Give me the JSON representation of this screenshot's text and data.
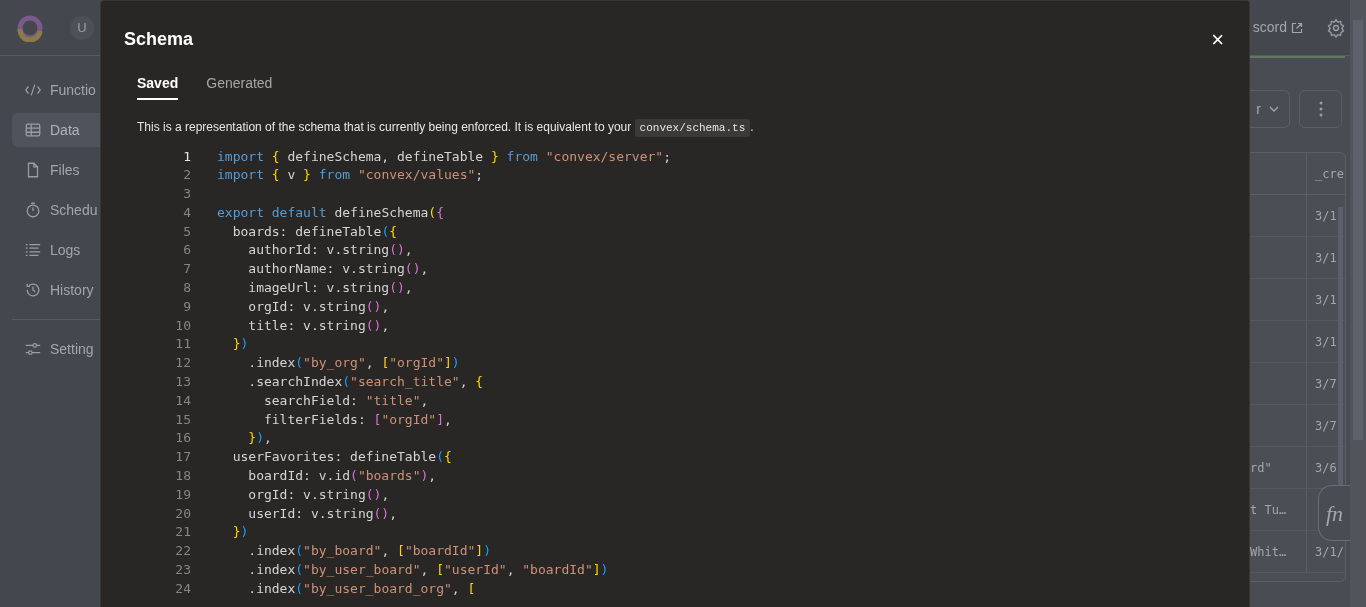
{
  "header": {
    "avatar": "U",
    "link": "scord"
  },
  "sidebar": {
    "items": [
      {
        "label": "Functio",
        "kind": "code",
        "selected": false
      },
      {
        "label": "Data",
        "kind": "table",
        "selected": true
      },
      {
        "label": "Files",
        "kind": "file",
        "selected": false
      },
      {
        "label": "Schedu",
        "kind": "timer",
        "selected": false
      },
      {
        "label": "Logs",
        "kind": "list",
        "selected": false
      },
      {
        "label": "History",
        "kind": "history",
        "selected": false
      }
    ],
    "footer_items": [
      {
        "label": "Setting",
        "kind": "sliders",
        "selected": false
      }
    ]
  },
  "toolbar": {
    "dropdown": "r"
  },
  "table": {
    "columns": [
      "_cre"
    ],
    "rows": [
      {
        "column_2": "3/1"
      },
      {
        "column_2": "3/1"
      },
      {
        "column_2": "3/1"
      },
      {
        "column_2": "3/1"
      },
      {
        "column_2": "3/7"
      },
      {
        "column_2": "3/7"
      },
      {
        "column_1": "rd\"",
        "column_2": "3/6"
      },
      {
        "column_1": "t Tu…"
      },
      {
        "column_1": "Whit…",
        "column_2": "3/1/"
      }
    ]
  },
  "function_button": "fn",
  "modal": {
    "title": "Schema",
    "close": "×",
    "tabs": [
      {
        "label": "Saved",
        "selected": true
      },
      {
        "label": "Generated",
        "selected": false
      }
    ],
    "description": "This is a representation of the schema that is currently being enforced. It is equivalent to your",
    "description_code": "convex/schema.ts",
    "description_end": ".",
    "code": [
      {
        "number": "1",
        "active": true,
        "tokens": [
          {
            "kind": "k",
            "text": "import"
          },
          {
            "kind": "y",
            "text": " {"
          },
          {
            "kind": "p",
            "text": " defineSchema, defineTable "
          },
          {
            "kind": "y",
            "text": "}"
          },
          {
            "kind": "k",
            "text": " from"
          },
          {
            "kind": "s",
            "text": " \"convex/server\""
          },
          {
            "kind": "p",
            "text": ";"
          }
        ]
      },
      {
        "number": "2",
        "active": false,
        "tokens": [
          {
            "kind": "k",
            "text": "import"
          },
          {
            "kind": "y",
            "text": " {"
          },
          {
            "kind": "p",
            "text": " v "
          },
          {
            "kind": "y",
            "text": "}"
          },
          {
            "kind": "k",
            "text": " from"
          },
          {
            "kind": "s",
            "text": " \"convex/values\""
          },
          {
            "kind": "p",
            "text": ";"
          }
        ]
      },
      {
        "number": "3",
        "active": false
      },
      {
        "number": "4",
        "active": false,
        "tokens": [
          {
            "kind": "k",
            "text": "export"
          },
          {
            "kind": "k",
            "text": " default"
          },
          {
            "kind": "p",
            "text": " defineSchema"
          },
          {
            "kind": "y",
            "text": "("
          },
          {
            "kind": "m",
            "text": "{"
          }
        ]
      },
      {
        "number": "5",
        "active": false,
        "tokens": [
          {
            "kind": "p",
            "text": "  boards: defineTable"
          },
          {
            "kind": "b",
            "text": "("
          },
          {
            "kind": "y",
            "text": "{"
          }
        ]
      },
      {
        "number": "6",
        "active": false,
        "tokens": [
          {
            "kind": "p",
            "text": "    authorId: v.string"
          },
          {
            "kind": "m",
            "text": "()"
          },
          {
            "kind": "p",
            "text": ","
          }
        ]
      },
      {
        "number": "7",
        "active": false,
        "tokens": [
          {
            "kind": "p",
            "text": "    authorName: v.string"
          },
          {
            "kind": "m",
            "text": "()"
          },
          {
            "kind": "p",
            "text": ","
          }
        ]
      },
      {
        "number": "8",
        "active": false,
        "tokens": [
          {
            "kind": "p",
            "text": "    imageUrl: v.string"
          },
          {
            "kind": "m",
            "text": "()"
          },
          {
            "kind": "p",
            "text": ","
          }
        ]
      },
      {
        "number": "9",
        "active": false,
        "tokens": [
          {
            "kind": "p",
            "text": "    orgId: v.string"
          },
          {
            "kind": "m",
            "text": "()"
          },
          {
            "kind": "p",
            "text": ","
          }
        ]
      },
      {
        "number": "10",
        "active": false,
        "tokens": [
          {
            "kind": "p",
            "text": "    title: v.string"
          },
          {
            "kind": "m",
            "text": "()"
          },
          {
            "kind": "p",
            "text": ","
          }
        ]
      },
      {
        "number": "11",
        "active": false,
        "tokens": [
          {
            "kind": "y",
            "text": "  }"
          },
          {
            "kind": "b",
            "text": ")"
          }
        ]
      },
      {
        "number": "12",
        "active": false,
        "tokens": [
          {
            "kind": "p",
            "text": "    .index"
          },
          {
            "kind": "b",
            "text": "("
          },
          {
            "kind": "s",
            "text": "\"by_org\""
          },
          {
            "kind": "p",
            "text": ","
          },
          {
            "kind": "y",
            "text": " ["
          },
          {
            "kind": "s",
            "text": "\"orgId\""
          },
          {
            "kind": "y",
            "text": "]"
          },
          {
            "kind": "b",
            "text": ")"
          }
        ]
      },
      {
        "number": "13",
        "active": false,
        "tokens": [
          {
            "kind": "p",
            "text": "    .searchIndex"
          },
          {
            "kind": "b",
            "text": "("
          },
          {
            "kind": "s",
            "text": "\"search_title\""
          },
          {
            "kind": "p",
            "text": ","
          },
          {
            "kind": "y",
            "text": " {"
          }
        ]
      },
      {
        "number": "14",
        "active": false,
        "tokens": [
          {
            "kind": "p",
            "text": "      searchField:"
          },
          {
            "kind": "s",
            "text": " \"title\""
          },
          {
            "kind": "p",
            "text": ","
          }
        ]
      },
      {
        "number": "15",
        "active": false,
        "tokens": [
          {
            "kind": "p",
            "text": "      filterFields:"
          },
          {
            "kind": "m",
            "text": " ["
          },
          {
            "kind": "s",
            "text": "\"orgId\""
          },
          {
            "kind": "m",
            "text": "]"
          },
          {
            "kind": "p",
            "text": ","
          }
        ]
      },
      {
        "number": "16",
        "active": false,
        "tokens": [
          {
            "kind": "y",
            "text": "    }"
          },
          {
            "kind": "b",
            "text": ")"
          },
          {
            "kind": "p",
            "text": ","
          }
        ]
      },
      {
        "number": "17",
        "active": false,
        "tokens": [
          {
            "kind": "p",
            "text": "  userFavorites: defineTable"
          },
          {
            "kind": "b",
            "text": "("
          },
          {
            "kind": "y",
            "text": "{"
          }
        ]
      },
      {
        "number": "18",
        "active": false,
        "tokens": [
          {
            "kind": "p",
            "text": "    boardId: v.id"
          },
          {
            "kind": "m",
            "text": "("
          },
          {
            "kind": "s",
            "text": "\"boards\""
          },
          {
            "kind": "m",
            "text": ")"
          },
          {
            "kind": "p",
            "text": ","
          }
        ]
      },
      {
        "number": "19",
        "active": false,
        "tokens": [
          {
            "kind": "p",
            "text": "    orgId: v.string"
          },
          {
            "kind": "m",
            "text": "()"
          },
          {
            "kind": "p",
            "text": ","
          }
        ]
      },
      {
        "number": "20",
        "active": false,
        "tokens": [
          {
            "kind": "p",
            "text": "    userId: v.string"
          },
          {
            "kind": "m",
            "text": "()"
          },
          {
            "kind": "p",
            "text": ","
          }
        ]
      },
      {
        "number": "21",
        "active": false,
        "tokens": [
          {
            "kind": "y",
            "text": "  }"
          },
          {
            "kind": "b",
            "text": ")"
          }
        ]
      },
      {
        "number": "22",
        "active": false,
        "tokens": [
          {
            "kind": "p",
            "text": "    .index"
          },
          {
            "kind": "b",
            "text": "("
          },
          {
            "kind": "s",
            "text": "\"by_board\""
          },
          {
            "kind": "p",
            "text": ","
          },
          {
            "kind": "y",
            "text": " ["
          },
          {
            "kind": "s",
            "text": "\"boardId\""
          },
          {
            "kind": "y",
            "text": "]"
          },
          {
            "kind": "b",
            "text": ")"
          }
        ]
      },
      {
        "number": "23",
        "active": false,
        "tokens": [
          {
            "kind": "p",
            "text": "    .index"
          },
          {
            "kind": "b",
            "text": "("
          },
          {
            "kind": "s",
            "text": "\"by_user_board\""
          },
          {
            "kind": "p",
            "text": ","
          },
          {
            "kind": "y",
            "text": " ["
          },
          {
            "kind": "s",
            "text": "\"userId\""
          },
          {
            "kind": "p",
            "text": ","
          },
          {
            "kind": "s",
            "text": " \"boardId\""
          },
          {
            "kind": "y",
            "text": "]"
          },
          {
            "kind": "b",
            "text": ")"
          }
        ]
      },
      {
        "number": "24",
        "active": false,
        "tokens": [
          {
            "kind": "p",
            "text": "    .index"
          },
          {
            "kind": "b",
            "text": "("
          },
          {
            "kind": "s",
            "text": "\"by_user_board_org\""
          },
          {
            "kind": "p",
            "text": ","
          },
          {
            "kind": "y",
            "text": " ["
          }
        ]
      }
    ]
  }
}
